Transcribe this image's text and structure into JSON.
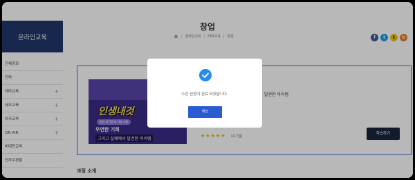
{
  "header": {
    "title": "창업",
    "breadcrumb": [
      "온라인교육",
      "테마교육",
      "창업"
    ]
  },
  "social": [
    "f",
    "t",
    "k",
    "b"
  ],
  "sidebar": {
    "heading": "온라인교육",
    "items": [
      {
        "label": "전체강좌",
        "expandable": false
      },
      {
        "label": "전략",
        "expandable": false
      },
      {
        "label": "테마교육",
        "expandable": true
      },
      {
        "label": "세무교육",
        "expandable": true
      },
      {
        "label": "외국교육",
        "expandable": true
      },
      {
        "label": "ON AIR",
        "expandable": true
      },
      {
        "label": "비대면교육",
        "expandable": false
      },
      {
        "label": "전자우편함",
        "expandable": false
      }
    ]
  },
  "course": {
    "subtitle": "발견한 아이템",
    "thumb_big_text": "인생내것",
    "thumb_pill": "창업 아이템 & 자금 지원",
    "thumb_line1": "우연한 기회",
    "thumb_line2": "그리고 실패에서 발견한 아이템",
    "stars": "★★★★★",
    "rating": "(4.7점)",
    "learn_button": "학습하기"
  },
  "section": {
    "title": "과정 소개"
  },
  "dialog": {
    "message": "수강 신청이 완료 되었습니다.",
    "ok_label": "확인"
  },
  "colors": {
    "accent": "#2a5bd0",
    "sidebar": "#22366b"
  }
}
